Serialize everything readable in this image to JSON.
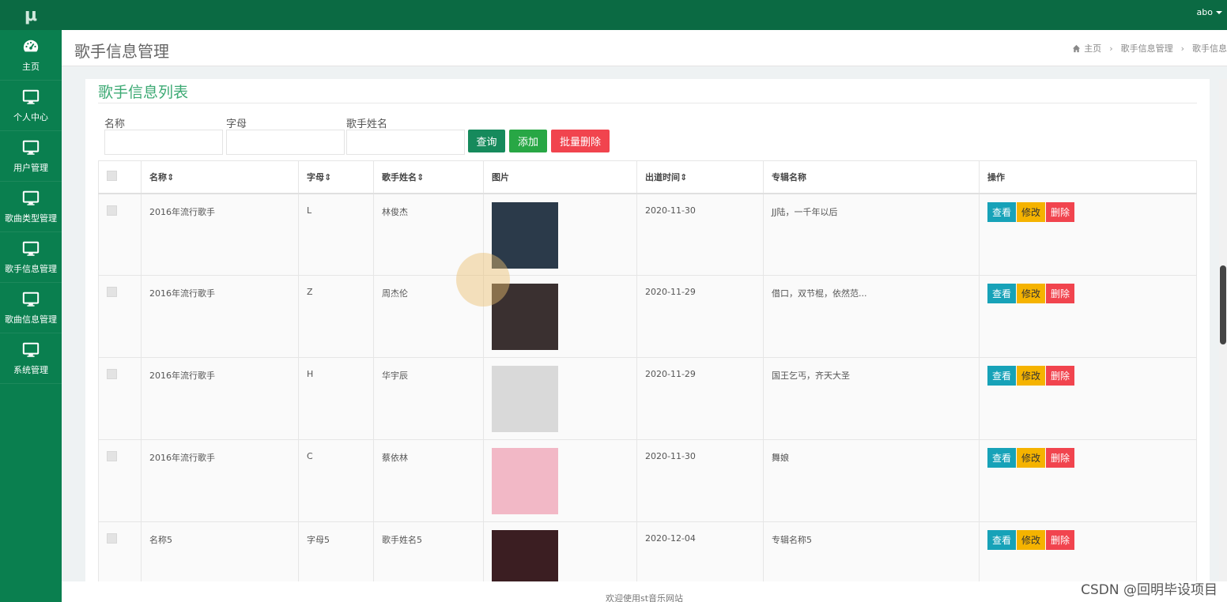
{
  "app": {
    "logo": "μ",
    "user": "abo"
  },
  "sidebar": {
    "items": [
      {
        "label": "主页",
        "icon": "dashboard-icon"
      },
      {
        "label": "个人中心",
        "icon": "monitor-icon"
      },
      {
        "label": "用户管理",
        "icon": "monitor-icon"
      },
      {
        "label": "歌曲类型管理",
        "icon": "monitor-icon"
      },
      {
        "label": "歌手信息管理",
        "icon": "monitor-icon"
      },
      {
        "label": "歌曲信息管理",
        "icon": "monitor-icon"
      },
      {
        "label": "系统管理",
        "icon": "monitor-icon"
      }
    ]
  },
  "header": {
    "title": "歌手信息管理",
    "breadcrumb": [
      "主页",
      "歌手信息管理",
      "歌手信息"
    ]
  },
  "panel": {
    "title": "歌手信息列表",
    "search": {
      "name_label": "名称",
      "letter_label": "字母",
      "singer_label": "歌手姓名",
      "name_value": "",
      "letter_value": "",
      "singer_value": ""
    },
    "buttons": {
      "query": "查询",
      "add": "添加",
      "batch_delete": "批量删除"
    }
  },
  "table": {
    "headers": {
      "name": "名称⇕",
      "letter": "字母⇕",
      "singer": "歌手姓名⇕",
      "image": "图片",
      "debut": "出道时间⇕",
      "album": "专辑名称",
      "ops": "操作"
    },
    "ops": {
      "view": "查看",
      "edit": "修改",
      "delete": "删除"
    },
    "rows": [
      {
        "name": "2016年流行歌手",
        "letter": "L",
        "singer": "林俊杰",
        "debut": "2020-11-30",
        "album": "JJ陆，一千年以后",
        "img_color": "#2b3a4a"
      },
      {
        "name": "2016年流行歌手",
        "letter": "Z",
        "singer": "周杰伦",
        "debut": "2020-11-29",
        "album": "借口，双节棍，依然范...",
        "img_color": "#3a3030"
      },
      {
        "name": "2016年流行歌手",
        "letter": "H",
        "singer": "华宇辰",
        "debut": "2020-11-29",
        "album": "国王乞丐，齐天大圣",
        "img_color": "#d9d9d9"
      },
      {
        "name": "2016年流行歌手",
        "letter": "C",
        "singer": "蔡依林",
        "debut": "2020-11-30",
        "album": "舞娘",
        "img_color": "#f2b8c6"
      },
      {
        "name": "名称5",
        "letter": "字母5",
        "singer": "歌手姓名5",
        "debut": "2020-12-04",
        "album": "专辑名称5",
        "img_color": "#3b1e22"
      }
    ]
  },
  "footer": {
    "text": "欢迎使用st音乐网站"
  },
  "watermark": "CSDN @回明毕设项目"
}
